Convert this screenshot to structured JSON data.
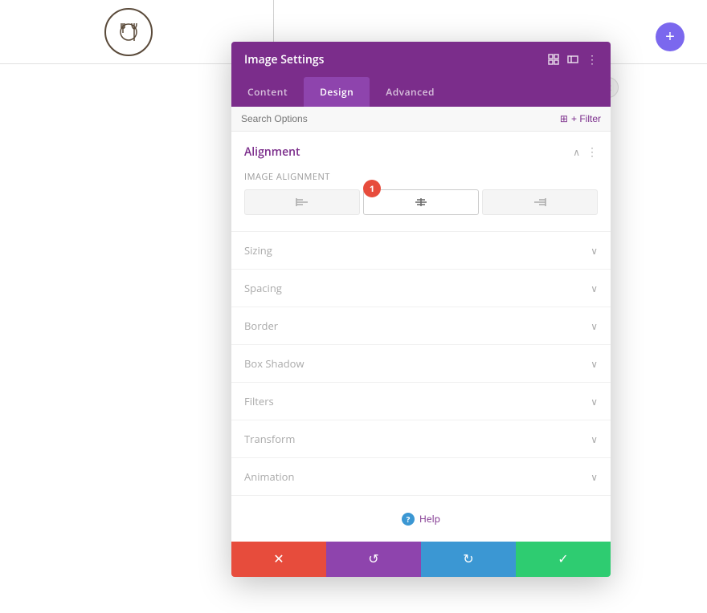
{
  "page": {
    "background_color": "#ffffff"
  },
  "header": {
    "logo_alt": "Restaurant logo with fork and knife"
  },
  "plus_button": {
    "label": "+"
  },
  "modal": {
    "title": "Image Settings",
    "tabs": [
      {
        "id": "content",
        "label": "Content",
        "active": false
      },
      {
        "id": "design",
        "label": "Design",
        "active": true
      },
      {
        "id": "advanced",
        "label": "Advanced",
        "active": false
      }
    ],
    "search_placeholder": "Search Options",
    "filter_label": "+ Filter",
    "sections": {
      "alignment": {
        "title": "Alignment",
        "field_label": "Image Alignment",
        "badge": "1",
        "options": [
          {
            "id": "left",
            "active": false
          },
          {
            "id": "center",
            "active": true
          },
          {
            "id": "right",
            "active": false
          }
        ]
      },
      "collapsible": [
        {
          "id": "sizing",
          "label": "Sizing"
        },
        {
          "id": "spacing",
          "label": "Spacing"
        },
        {
          "id": "border",
          "label": "Border"
        },
        {
          "id": "box-shadow",
          "label": "Box Shadow"
        },
        {
          "id": "filters",
          "label": "Filters"
        },
        {
          "id": "transform",
          "label": "Transform"
        },
        {
          "id": "animation",
          "label": "Animation"
        }
      ]
    },
    "help_label": "Help",
    "footer": {
      "cancel_icon": "✕",
      "undo_icon": "↺",
      "redo_icon": "↻",
      "save_icon": "✓"
    }
  }
}
